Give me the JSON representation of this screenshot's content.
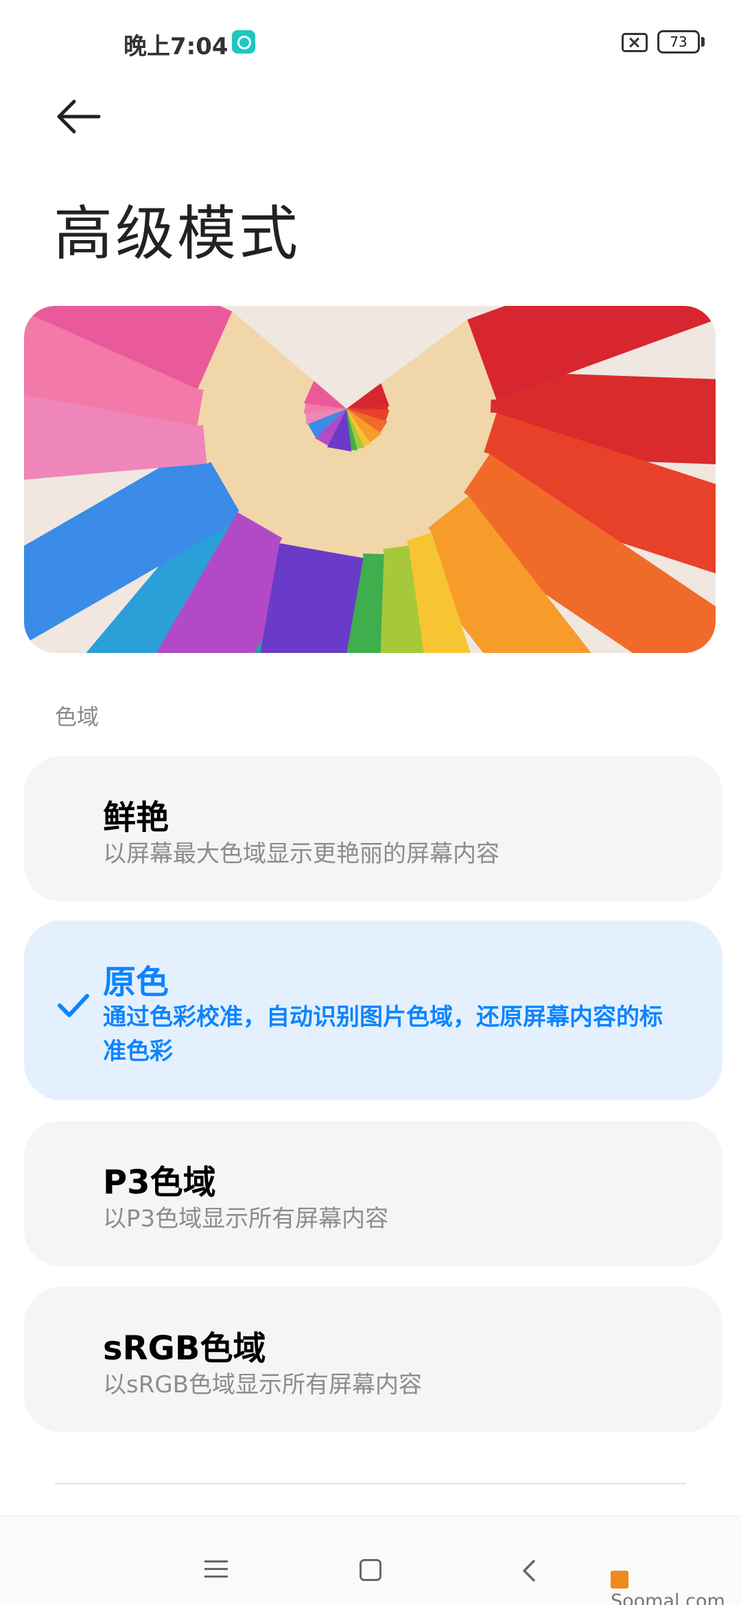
{
  "status_bar": {
    "time": "晚上7:04",
    "battery": "73"
  },
  "header": {
    "title": "高级模式"
  },
  "hero": {
    "image_icon": "colored-pencils-image"
  },
  "section": {
    "label": "色域"
  },
  "options": [
    {
      "title": "鲜艳",
      "desc": "以屏幕最大色域显示更艳丽的屏幕内容",
      "selected": false
    },
    {
      "title": "原色",
      "desc": "通过色彩校准，自动识别图片色域，还原屏幕内容的标准色彩",
      "selected": true
    },
    {
      "title": "P3色域",
      "desc": "以P3色域显示所有屏幕内容",
      "selected": false
    },
    {
      "title": "sRGB色域",
      "desc": "以sRGB色域显示所有屏幕内容",
      "selected": false
    }
  ],
  "colors": {
    "accent": "#0d84ff",
    "selected_bg": "#e4f0fd",
    "card_bg": "#f5f5f5"
  },
  "watermark": {
    "text": "Soomal.com"
  }
}
